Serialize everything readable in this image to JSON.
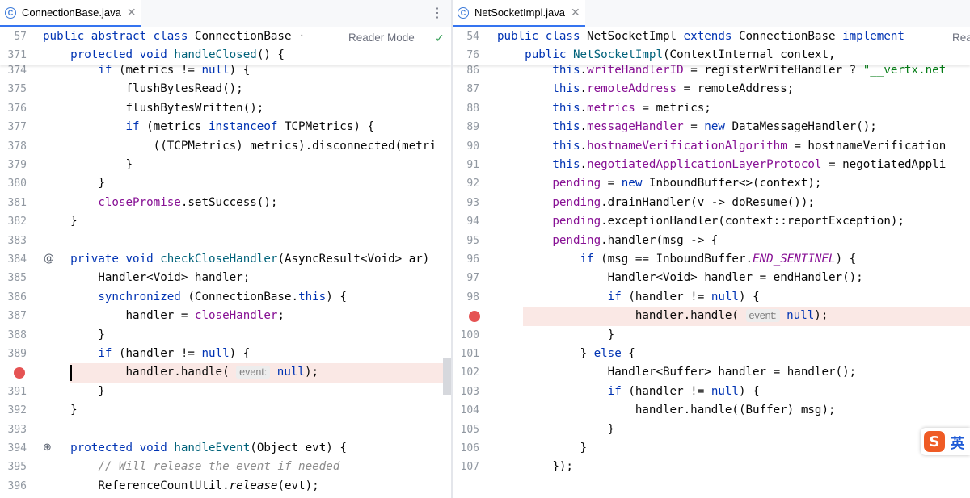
{
  "left_pane": {
    "tab_title": "ConnectionBase.java",
    "tab_icon": "java-class-icon",
    "reader_mode": "Reader Mode",
    "sticky": [
      {
        "num": "57",
        "html": "<span class=\"kw\">public abstract class</span> ConnectionBase <span style=\"color:#8c8c8c\">·</span>"
      },
      {
        "num": "371",
        "html": "    <span class=\"kw\">protected void</span> <span class=\"fnd\">handleClosed</span>() {"
      }
    ],
    "lines": [
      {
        "num": "374",
        "html": "        <span class=\"kw\">if</span> (metrics != <span class=\"kw\">null</span>) {"
      },
      {
        "num": "375",
        "html": "            flushBytesRead();"
      },
      {
        "num": "376",
        "html": "            flushBytesWritten();"
      },
      {
        "num": "377",
        "html": "            <span class=\"kw\">if</span> (metrics <span class=\"kw\">instanceof</span> TCPMetrics) {"
      },
      {
        "num": "378",
        "html": "                ((TCPMetrics) metrics).disconnected(metri"
      },
      {
        "num": "379",
        "html": "            }"
      },
      {
        "num": "380",
        "html": "        }"
      },
      {
        "num": "381",
        "html": "        <span class=\"fld\">closePromise</span>.setSuccess();"
      },
      {
        "num": "382",
        "html": "    }"
      },
      {
        "num": "383",
        "html": ""
      },
      {
        "num": "384",
        "html": "    <span class=\"kw\">private void</span> <span class=\"fnd\">checkCloseHandler</span>(AsyncResult&lt;Void&gt; ar)"
      },
      {
        "num": "385",
        "html": "        Handler&lt;Void&gt; handler;"
      },
      {
        "num": "386",
        "html": "        <span class=\"kw\">synchronized</span> (ConnectionBase.<span class=\"kw\">this</span>) {"
      },
      {
        "num": "387",
        "html": "            handler = <span class=\"fld\">closeHandler</span>;"
      },
      {
        "num": "388",
        "html": "        }"
      },
      {
        "num": "389",
        "html": "        <span class=\"kw\">if</span> (handler != <span class=\"kw\">null</span>) {"
      },
      {
        "num": "",
        "html": "            handler.handle( <span class=\"hint\">event:</span> <span class=\"kw\">null</span>);",
        "highlight": true,
        "breakpoint": true
      },
      {
        "num": "391",
        "html": "        }"
      },
      {
        "num": "392",
        "html": "    }"
      },
      {
        "num": "393",
        "html": ""
      },
      {
        "num": "394",
        "html": "    <span class=\"kw\">protected void</span> <span class=\"fnd\">handleEvent</span>(Object evt) {"
      },
      {
        "num": "395",
        "html": "        <span class=\"cmt\">// Will release the event if needed</span>"
      },
      {
        "num": "396",
        "html": "        ReferenceCountUtil.<span class=\"st\">release</span>(evt);"
      }
    ]
  },
  "right_pane": {
    "tab_title": "NetSocketImpl.java",
    "tab_icon": "java-class-icon",
    "reader_mode": "Rea",
    "sticky": [
      {
        "num": "54",
        "html": "<span class=\"kw\">public class</span> NetSocketImpl <span class=\"kw\">extends</span> ConnectionBase <span class=\"kw\">implement</span>"
      },
      {
        "num": "76",
        "html": "    <span class=\"kw\">public</span> <span class=\"fnd\">NetSocketImpl</span>(ContextInternal context,"
      }
    ],
    "lines": [
      {
        "num": "86",
        "html": "        <span class=\"kw\">this</span>.<span class=\"fld\">writeHandlerID</span> = registerWriteHandler ? <span class=\"str\">\"__vertx.net</span>"
      },
      {
        "num": "87",
        "html": "        <span class=\"kw\">this</span>.<span class=\"fld\">remoteAddress</span> = remoteAddress;"
      },
      {
        "num": "88",
        "html": "        <span class=\"kw\">this</span>.<span class=\"fld\">metrics</span> = metrics;"
      },
      {
        "num": "89",
        "html": "        <span class=\"kw\">this</span>.<span class=\"fld\">messageHandler</span> = <span class=\"kw\">new</span> DataMessageHandler();"
      },
      {
        "num": "90",
        "html": "        <span class=\"kw\">this</span>.<span class=\"fld\">hostnameVerificationAlgorithm</span> = hostnameVerification"
      },
      {
        "num": "91",
        "html": "        <span class=\"kw\">this</span>.<span class=\"fld\">negotiatedApplicationLayerProtocol</span> = negotiatedAppli"
      },
      {
        "num": "92",
        "html": "        <span class=\"fld\">pending</span> = <span class=\"kw\">new</span> InboundBuffer&lt;&gt;(context);"
      },
      {
        "num": "93",
        "html": "        <span class=\"fld\">pending</span>.drainHandler(v -&gt; doResume());"
      },
      {
        "num": "94",
        "html": "        <span class=\"fld\">pending</span>.exceptionHandler(context::reportException);"
      },
      {
        "num": "95",
        "html": "        <span class=\"fld\">pending</span>.handler(msg -&gt; {"
      },
      {
        "num": "96",
        "html": "            <span class=\"kw\">if</span> (msg == InboundBuffer.<span class=\"fld st\">END_SENTINEL</span>) {"
      },
      {
        "num": "97",
        "html": "                Handler&lt;Void&gt; handler = endHandler();"
      },
      {
        "num": "98",
        "html": "                <span class=\"kw\">if</span> (handler != <span class=\"kw\">null</span>) {"
      },
      {
        "num": "",
        "html": "                    handler.handle( <span class=\"hint\">event:</span> <span class=\"kw\">null</span>);",
        "highlight": true,
        "breakpoint": true
      },
      {
        "num": "100",
        "html": "                }"
      },
      {
        "num": "101",
        "html": "            } <span class=\"kw\">else</span> {"
      },
      {
        "num": "102",
        "html": "                Handler&lt;Buffer&gt; handler = handler();"
      },
      {
        "num": "103",
        "html": "                <span class=\"kw\">if</span> (handler != <span class=\"kw\">null</span>) {"
      },
      {
        "num": "104",
        "html": "                    handler.handle((Buffer) msg);"
      },
      {
        "num": "105",
        "html": "                }"
      },
      {
        "num": "106",
        "html": "            }"
      },
      {
        "num": "107",
        "html": "        });"
      }
    ]
  },
  "ime": {
    "logo": "S",
    "lang": "英"
  },
  "colors": {
    "keyword": "#0033b3",
    "field": "#871094",
    "method_decl": "#00627a",
    "breakpoint": "#e55353",
    "highlight_row": "#fae8e5",
    "tab_underline": "#3574f0"
  }
}
